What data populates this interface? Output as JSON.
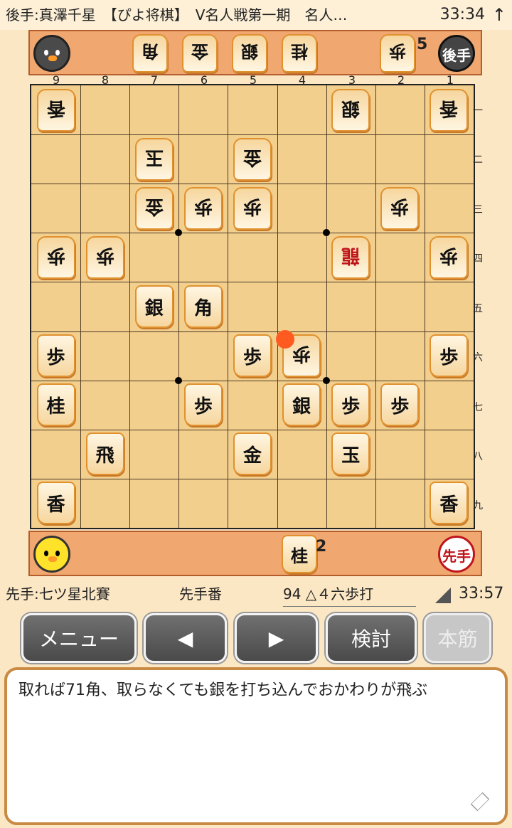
{
  "title_bar": {
    "text": "後手:真澤千星　【ぴよ将棋】　V名人戦第一期　名人…",
    "clock": "33:34",
    "up_arrow": "↑"
  },
  "gote_hand": {
    "badge": "後手",
    "pieces": [
      "角",
      "金",
      "銀",
      "桂",
      "歩"
    ],
    "fu_count": "5"
  },
  "sente_hand": {
    "badge": "先手",
    "pieces": [
      "桂"
    ],
    "kei_count": "2"
  },
  "file_labels": [
    "9",
    "8",
    "7",
    "6",
    "5",
    "4",
    "3",
    "2",
    "1"
  ],
  "rank_labels": [
    "一",
    "二",
    "三",
    "四",
    "五",
    "六",
    "七",
    "八",
    "九"
  ],
  "board": {
    "gote": [
      {
        "label": "香",
        "file": 9,
        "rank": 1
      },
      {
        "label": "銀",
        "file": 3,
        "rank": 1
      },
      {
        "label": "香",
        "file": 1,
        "rank": 1
      },
      {
        "label": "玉",
        "file": 7,
        "rank": 2
      },
      {
        "label": "金",
        "file": 5,
        "rank": 2
      },
      {
        "label": "金",
        "file": 7,
        "rank": 3
      },
      {
        "label": "歩",
        "file": 6,
        "rank": 3
      },
      {
        "label": "歩",
        "file": 5,
        "rank": 3
      },
      {
        "label": "歩",
        "file": 2,
        "rank": 3
      },
      {
        "label": "歩",
        "file": 9,
        "rank": 4
      },
      {
        "label": "歩",
        "file": 8,
        "rank": 4
      },
      {
        "label": "龍",
        "file": 3,
        "rank": 4,
        "promoted": true
      },
      {
        "label": "歩",
        "file": 1,
        "rank": 4
      },
      {
        "label": "歩",
        "file": 4,
        "rank": 6
      }
    ],
    "sente": [
      {
        "label": "銀",
        "file": 7,
        "rank": 5
      },
      {
        "label": "角",
        "file": 6,
        "rank": 5
      },
      {
        "label": "歩",
        "file": 9,
        "rank": 6
      },
      {
        "label": "歩",
        "file": 5,
        "rank": 6
      },
      {
        "label": "歩",
        "file": 1,
        "rank": 6
      },
      {
        "label": "桂",
        "file": 9,
        "rank": 7
      },
      {
        "label": "歩",
        "file": 6,
        "rank": 7
      },
      {
        "label": "銀",
        "file": 4,
        "rank": 7
      },
      {
        "label": "歩",
        "file": 3,
        "rank": 7
      },
      {
        "label": "歩",
        "file": 2,
        "rank": 7
      },
      {
        "label": "飛",
        "file": 8,
        "rank": 8
      },
      {
        "label": "金",
        "file": 5,
        "rank": 8
      },
      {
        "label": "玉",
        "file": 3,
        "rank": 8
      },
      {
        "label": "香",
        "file": 9,
        "rank": 9
      },
      {
        "label": "香",
        "file": 1,
        "rank": 9
      }
    ],
    "last_move": {
      "file": 4,
      "rank": 6
    }
  },
  "info": {
    "sente_name": "先手:七ツ星北賽",
    "turn": "先手番",
    "move": "94 △４六歩打",
    "clock": "33:57"
  },
  "buttons": {
    "menu": "メニュー",
    "prev": "◀",
    "next": "▶",
    "review": "検討",
    "honsuji": "本筋"
  },
  "comment": "取れば71角、取らなくても銀を打ち込んでおかわりが飛ぶ"
}
